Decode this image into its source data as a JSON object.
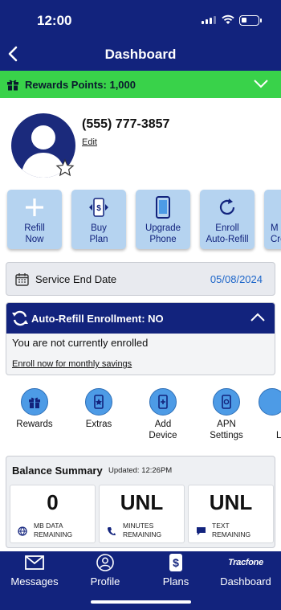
{
  "status_bar": {
    "time": "12:00"
  },
  "header": {
    "title": "Dashboard"
  },
  "rewards": {
    "label": "Rewards Points: 1,000"
  },
  "profile": {
    "phone": "(555) 777-3857",
    "edit_label": "Edit"
  },
  "tiles": [
    {
      "line1": "Refill",
      "line2": "Now",
      "icon": "plus-icon"
    },
    {
      "line1": "Buy",
      "line2": "Plan",
      "icon": "buy-plan-icon"
    },
    {
      "line1": "Upgrade",
      "line2": "Phone",
      "icon": "phone-icon"
    },
    {
      "line1": "Enroll",
      "line2": "Auto-Refill",
      "icon": "refresh-icon"
    },
    {
      "line1": "M",
      "line2": "Cre",
      "icon": "partial-icon"
    }
  ],
  "service": {
    "label": "Service End Date",
    "date": "05/08/2024"
  },
  "auto_refill": {
    "title": "Auto-Refill Enrollment:  NO",
    "message": "You are not currently enrolled",
    "link": "Enroll now for monthly savings"
  },
  "shortcuts": [
    {
      "line1": "Rewards",
      "line2": "",
      "icon": "gift-icon"
    },
    {
      "line1": "Extras",
      "line2": "",
      "icon": "extras-icon"
    },
    {
      "line1": "Add",
      "line2": "Device",
      "icon": "add-device-icon"
    },
    {
      "line1": "APN",
      "line2": "Settings",
      "icon": "apn-settings-icon"
    },
    {
      "line1": "L",
      "line2": "",
      "icon": "partial-icon"
    }
  ],
  "balance": {
    "title": "Balance Summary",
    "updated": "Updated: 12:26PM",
    "cards": [
      {
        "value": "0",
        "line1": "MB DATA",
        "line2": "REMAINING",
        "icon": "data-icon"
      },
      {
        "value": "UNL",
        "line1": "MINUTES",
        "line2": "REMAINING",
        "icon": "minutes-icon"
      },
      {
        "value": "UNL",
        "line1": "TEXT",
        "line2": "REMAINING",
        "icon": "text-icon"
      }
    ]
  },
  "tabbar": {
    "brand": "Tracfone",
    "items": [
      {
        "label": "Messages",
        "icon": "envelope-icon"
      },
      {
        "label": "Profile",
        "icon": "person-icon"
      },
      {
        "label": "Plans",
        "icon": "dollar-icon"
      },
      {
        "label": "Dashboard",
        "icon": "brand-logo"
      }
    ]
  },
  "colors": {
    "navy": "#12237d",
    "green": "#39d24a",
    "tile": "#b5d3f0",
    "link_blue": "#1d66c9",
    "circle": "#4d9be6"
  }
}
